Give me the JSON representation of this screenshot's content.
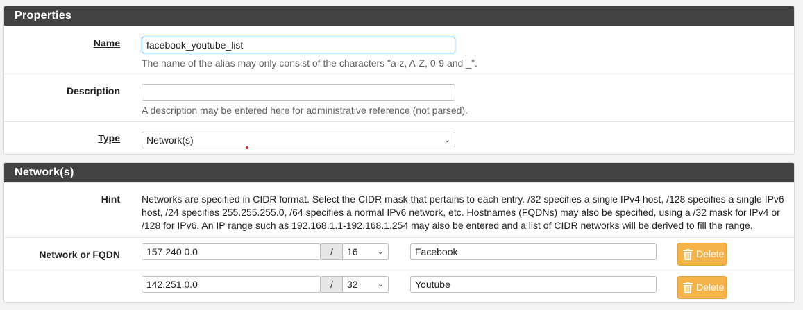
{
  "properties": {
    "heading": "Properties",
    "name_label": "Name",
    "name_value": "facebook_youtube_list",
    "name_help": "The name of the alias may only consist of the characters \"a-z, A-Z, 0-9 and _\".",
    "description_label": "Description",
    "description_value": "",
    "description_help": "A description may be entered here for administrative reference (not parsed).",
    "type_label": "Type",
    "type_value": "Network(s)"
  },
  "networks": {
    "heading": "Network(s)",
    "hint_label": "Hint",
    "hint_text": "Networks are specified in CIDR format. Select the CIDR mask that pertains to each entry. /32 specifies a single IPv4 host, /128 specifies a single IPv6 host, /24 specifies 255.255.255.0, /64 specifies a normal IPv6 network, etc. Hostnames (FQDNs) may also be specified, using a /32 mask for IPv4 or /128 for IPv6. An IP range such as 192.168.1.1-192.168.1.254 may also be entered and a list of CIDR networks will be derived to fill the range.",
    "row_label": "Network or FQDN",
    "slash": "/",
    "entries": [
      {
        "address": "157.240.0.0",
        "mask": "16",
        "description": "Facebook",
        "delete_label": "Delete"
      },
      {
        "address": "142.251.0.0",
        "mask": "32",
        "description": "Youtube",
        "delete_label": "Delete"
      }
    ]
  },
  "colors": {
    "heading_bg": "#424242",
    "delete_bg": "#f5b44a",
    "focus_border": "#66afe9"
  }
}
